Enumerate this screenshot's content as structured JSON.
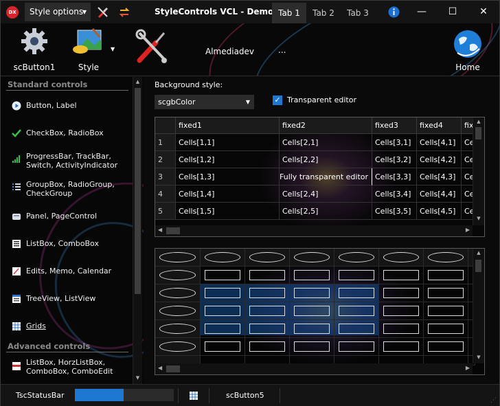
{
  "window": {
    "title": "StyleControls VCL - Demo",
    "app_icon_text": "DX",
    "style_options_label": "Style options",
    "tabs": [
      "Tab 1",
      "Tab 2",
      "Tab 3"
    ],
    "active_tab": "Tab 1",
    "controls": {
      "minimize": "—",
      "maximize": "☐",
      "close": "✕"
    }
  },
  "toolbar": {
    "buttons": [
      {
        "label": "scButton1",
        "icon": "gear-icon"
      },
      {
        "label": "Style",
        "icon": "paint-icon"
      },
      {
        "label": "",
        "icon": "tools-icon"
      }
    ],
    "user_text": "Almediadev",
    "dots_text": "...",
    "home_label": "Home"
  },
  "sidebar": {
    "standard_header": "Standard controls",
    "standard_items": [
      {
        "label": "Button, Label",
        "icon": "play-circle-icon"
      },
      {
        "label": "CheckBox, RadioBox",
        "icon": "checkmark-icon"
      },
      {
        "label": "ProgressBar, TrackBar, Switch, ActivityIndicator",
        "icon": "signal-bars-icon"
      },
      {
        "label": "GroupBox, RadioGroup, CheckGroup",
        "icon": "list-bullets-icon"
      },
      {
        "label": "Panel, PageControl",
        "icon": "panel-icon"
      },
      {
        "label": "ListBox, ComboBox",
        "icon": "listbox-icon"
      },
      {
        "label": "Edits, Memo, Calendar",
        "icon": "edit-icon"
      },
      {
        "label": "TreeView, ListView",
        "icon": "treeview-icon"
      },
      {
        "label": "Grids",
        "icon": "grid-icon",
        "selected": true
      }
    ],
    "advanced_header": "Advanced controls",
    "advanced_items": [
      {
        "label": "ListBox, HorzListBox, ComboBox, ComboEdit",
        "icon": "listbox-icon"
      }
    ]
  },
  "main": {
    "background_style_label": "Background style:",
    "background_style_value": "scgbColor",
    "transparent_editor_label": "Transparent editor",
    "transparent_editor_checked": true,
    "grid1": {
      "headers": [
        "",
        "fixed1",
        "fixed2",
        "fixed3",
        "fixed4",
        "fix"
      ],
      "rows": [
        [
          "1",
          "Cells[1,1]",
          "Cells[2,1]",
          "Cells[3,1]",
          "Cells[4,1]",
          "Ce"
        ],
        [
          "2",
          "Cells[1,2]",
          "Cells[2,2]",
          "Cells[3,2]",
          "Cells[4,2]",
          "Ce"
        ],
        [
          "3",
          "Cells[1,3]",
          "Fully transparent editor",
          "Cells[3,3]",
          "Cells[4,3]",
          "Ce"
        ],
        [
          "4",
          "Cells[1,4]",
          "Cells[2,4]",
          "Cells[3,4]",
          "Cells[4,4]",
          "Ce"
        ],
        [
          "5",
          "Cells[1,5]",
          "Cells[2,5]",
          "Cells[3,5]",
          "Cells[4,5]",
          "Ce"
        ]
      ]
    }
  },
  "statusbar": {
    "label": "TscStatusBar",
    "progress": 0.49,
    "button_label": "scButton5",
    "progress_color": "#1e78d2"
  },
  "colors": {
    "accent": "#1e78d2",
    "background": "#0c0c0c",
    "app_icon": "#d8252b"
  }
}
